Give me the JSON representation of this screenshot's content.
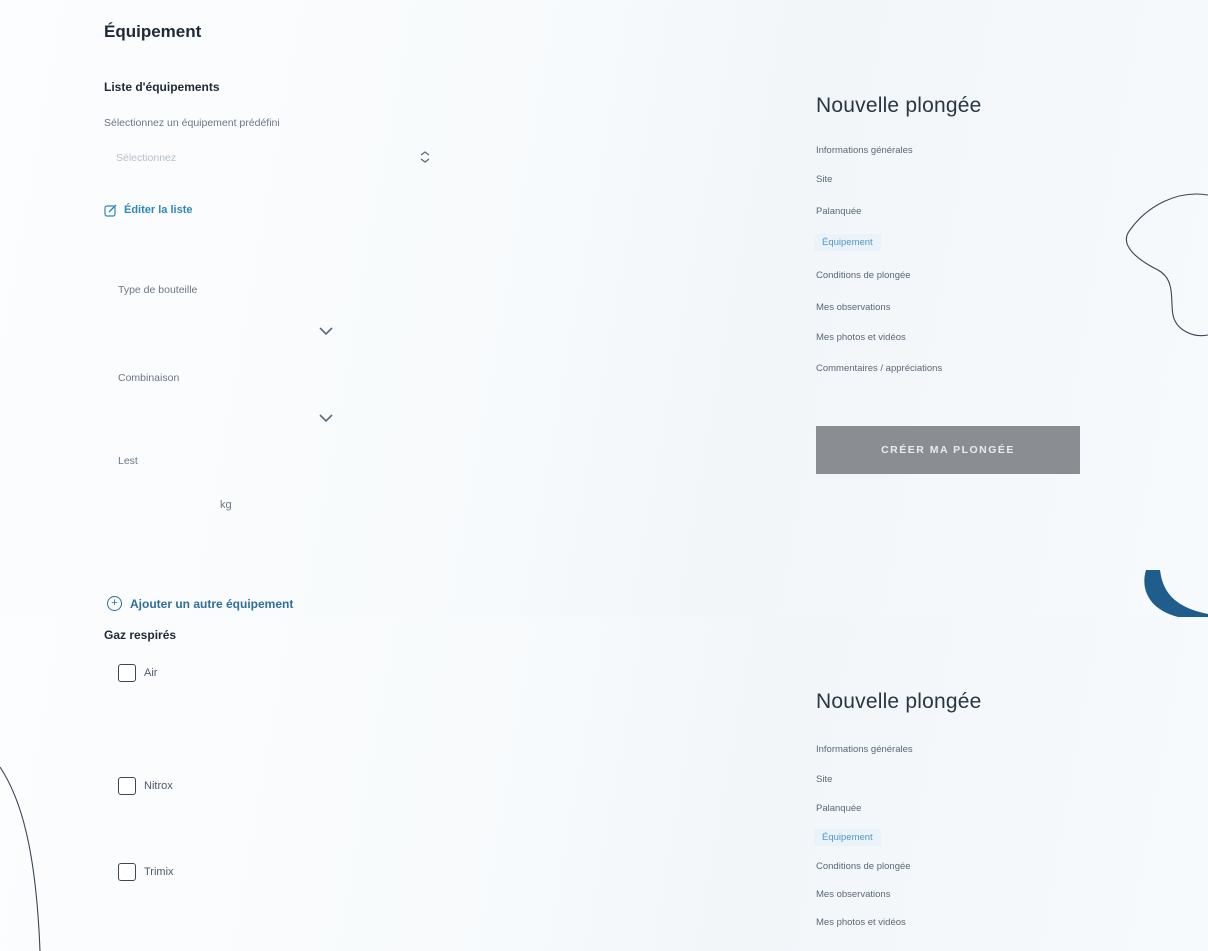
{
  "top": {
    "title": "Équipement",
    "equipment_list": {
      "heading": "Liste d'équipements",
      "select_label": "Sélectionnez un équipement prédéfini",
      "select_placeholder": "Sélectionnez",
      "edit_link": "Éditer la liste"
    },
    "bottle_type": {
      "label": "Type de bouteille",
      "value": ""
    },
    "suit": {
      "label": "Combinaison",
      "value": ""
    },
    "lest": {
      "label": "Lest",
      "value": "",
      "unit": "kg"
    },
    "add_equipment": "Ajouter un autre équipement"
  },
  "gases": {
    "heading": "Gaz respirés",
    "options": [
      {
        "label": "Air",
        "checked": false
      },
      {
        "label": "Nitrox",
        "checked": false
      },
      {
        "label": "Trimix",
        "checked": false
      }
    ]
  },
  "sidebar": {
    "title": "Nouvelle plongée",
    "items": [
      {
        "label": "Informations générales",
        "active": false
      },
      {
        "label": "Site",
        "active": false
      },
      {
        "label": "Palanquée",
        "active": false
      },
      {
        "label": "Équipement",
        "active": true
      },
      {
        "label": "Conditions de plongée",
        "active": false
      },
      {
        "label": "Mes observations",
        "active": false
      },
      {
        "label": "Mes photos et vidéos",
        "active": false
      },
      {
        "label": "Commentaires / appréciations",
        "active": false
      }
    ],
    "create_button": "CRÉER MA PLONGÉE"
  },
  "colors": {
    "accent": "#2f87b8",
    "active_item_bg": "#eaf3fa",
    "button_bg": "#8a8d92",
    "deco_blue": "#1f5d8c"
  }
}
